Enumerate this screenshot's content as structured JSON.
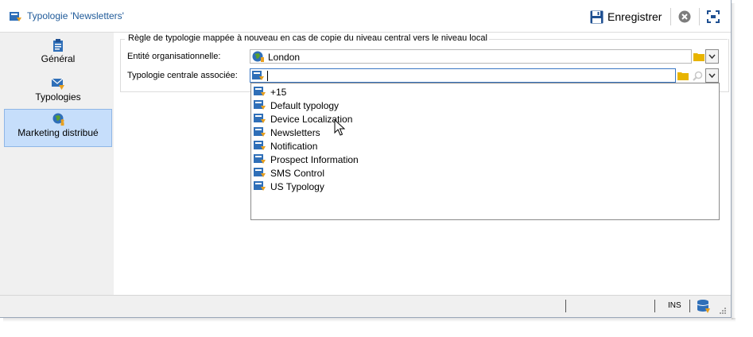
{
  "window": {
    "title": "Typologie 'Newsletters'",
    "save_label": "Enregistrer"
  },
  "sidebar": {
    "items": [
      {
        "label": "Général",
        "icon": "clipboard-icon",
        "active": false
      },
      {
        "label": "Typologies",
        "icon": "envelope-rules-icon",
        "active": false
      },
      {
        "label": "Marketing distribué",
        "icon": "globe-person-icon",
        "active": true
      }
    ]
  },
  "form": {
    "group_title": "Règle de typologie mappée à nouveau en cas de copie du niveau central vers le niveau local",
    "entity_label": "Entité organisationnelle:",
    "entity_value": "London",
    "central_label": "Typologie centrale associée:",
    "central_value": ""
  },
  "dropdown": {
    "items": [
      "+15",
      "Default typology",
      "Device Localization",
      "Newsletters",
      "Notification",
      "Prospect Information",
      "SMS Control",
      "US Typology"
    ]
  },
  "statusbar": {
    "ins": "INS"
  },
  "colors": {
    "title_blue": "#1f5a99",
    "active_bg": "#c6defb",
    "folder_yellow": "#e8b400"
  }
}
